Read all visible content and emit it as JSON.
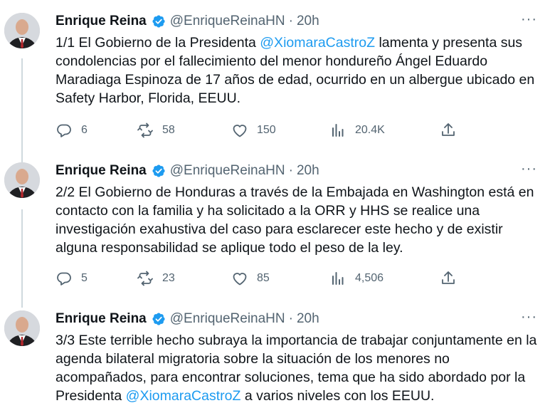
{
  "tweets": [
    {
      "name": "Enrique Reina",
      "handle": "@EnriqueReinaHN",
      "time": "20h",
      "text_parts": [
        {
          "text": "1/1 El Gobierno de la Presidenta ",
          "mention": false
        },
        {
          "text": "@XiomaraCastroZ",
          "mention": true
        },
        {
          "text": "  lamenta y presenta sus condolencias por el fallecimiento del menor hondureño Ángel Eduardo Maradiaga Espinoza de 17 años de edad, ocurrido en un albergue ubicado en Safety Harbor, Florida, EEUU.",
          "mention": false
        }
      ],
      "replies": "6",
      "retweets": "58",
      "likes": "150",
      "views": "20.4K"
    },
    {
      "name": "Enrique Reina",
      "handle": "@EnriqueReinaHN",
      "time": "20h",
      "text_parts": [
        {
          "text": "2/2 El Gobierno de Honduras a través de la Embajada en Washington está en contacto con la familia y ha solicitado a la ORR y HHS se realice una investigación exahustiva del caso para esclarecer este hecho y de existir alguna responsabilidad se aplique todo el peso de la ley.",
          "mention": false
        }
      ],
      "replies": "5",
      "retweets": "23",
      "likes": "85",
      "views": "4,506"
    },
    {
      "name": "Enrique Reina",
      "handle": "@EnriqueReinaHN",
      "time": "20h",
      "text_parts": [
        {
          "text": "3/3 Este terrible hecho subraya la importancia de trabajar conjuntamente en la agenda bilateral migratoria sobre la situación de los menores no acompañados, para encontrar soluciones, tema que ha sido abordado por la Presidenta ",
          "mention": false
        },
        {
          "text": "@XiomaraCastroZ",
          "mention": true
        },
        {
          "text": " a varios niveles con los EEUU.",
          "mention": false
        }
      ]
    }
  ],
  "more_glyph": "···",
  "separator": "·",
  "colors": {
    "accent": "#1d9bf0",
    "secondary_text": "#536471",
    "thread_line": "#cfd9de"
  },
  "icons": [
    "verified-badge-icon",
    "more-icon",
    "reply-icon",
    "retweet-icon",
    "like-icon",
    "views-icon",
    "share-icon"
  ]
}
